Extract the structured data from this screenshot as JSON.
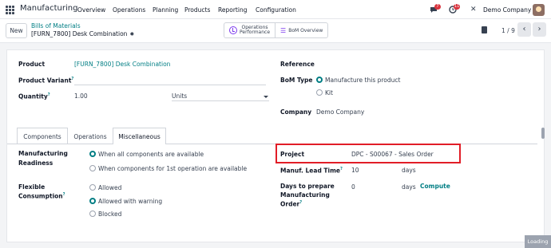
{
  "nav": {
    "app_title": "Manufacturing",
    "menu": [
      "Overview",
      "Operations",
      "Planning",
      "Products",
      "Reporting",
      "Configuration"
    ],
    "messages_badge": "7",
    "activities_badge": "11",
    "company": "Demo Company"
  },
  "control": {
    "new_label": "New",
    "breadcrumb": "Bills of Materials",
    "record_name": "[FURN_7800] Desk Combination",
    "smart_operations_line1": "Operations",
    "smart_operations_line2": "Performance",
    "smart_bom": "BoM Overview",
    "pager": "1 / 9"
  },
  "form": {
    "product_label": "Product",
    "product_value": "[FURN_7800] Desk Combination",
    "variant_label": "Product Variant",
    "quantity_label": "Quantity",
    "quantity_value": "1.00",
    "uom_value": "Units",
    "reference_label": "Reference",
    "bom_type_label": "BoM Type",
    "bom_type_options": [
      "Manufacture this product",
      "Kit"
    ],
    "company_label": "Company",
    "company_value": "Demo Company"
  },
  "tabs": [
    "Components",
    "Operations",
    "Miscellaneous"
  ],
  "misc": {
    "readiness_label_1": "Manufacturing",
    "readiness_label_2": "Readiness",
    "readiness_options": [
      "When all components are available",
      "When components for 1st operation are available"
    ],
    "flexible_label_1": "Flexible",
    "flexible_label_2": "Consumption",
    "flexible_options": [
      "Allowed",
      "Allowed with warning",
      "Blocked"
    ],
    "project_label": "Project",
    "project_value": "DPC - S00067 - Sales Order",
    "lead_time_label": "Manuf. Lead Time",
    "lead_time_value": "10",
    "lead_time_unit": "days",
    "prepare_label_1": "Days to prepare",
    "prepare_label_2": "Manufacturing",
    "prepare_label_3": "Order",
    "prepare_value": "0",
    "prepare_unit": "days",
    "compute_label": "Compute"
  },
  "status": {
    "loading": "Loading"
  },
  "colors": {
    "accent": "#017e84",
    "highlight": "#e11d27",
    "badge": "#d9353f"
  }
}
